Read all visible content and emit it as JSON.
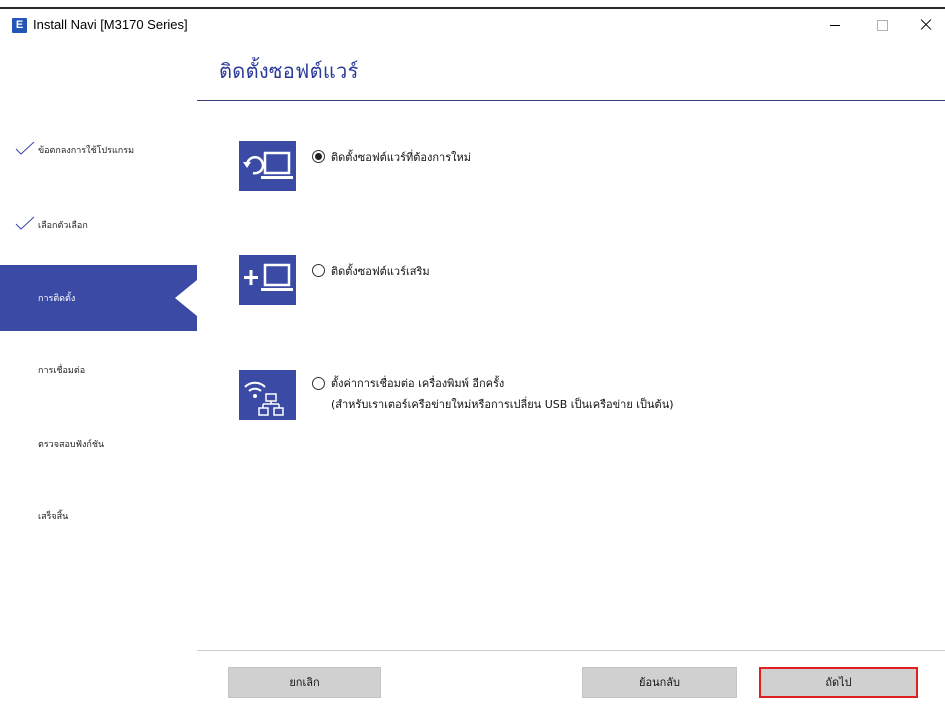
{
  "window": {
    "title": "Install Navi [M3170 Series]",
    "app_icon_letter": "E"
  },
  "header": {
    "title": "ติดตั้งซอฟต์แวร์"
  },
  "sidebar": {
    "steps": [
      {
        "label": "ข้อตกลงการใช้โปรแกรม",
        "state": "done"
      },
      {
        "label": "เลือกตัวเลือก",
        "state": "done"
      },
      {
        "label": "การติดตั้ง",
        "state": "active"
      },
      {
        "label": "การเชื่อมต่อ",
        "state": "pending"
      },
      {
        "label": "ตรวจสอบฟังก์ชัน",
        "state": "pending"
      },
      {
        "label": "เสร็จสิ้น",
        "state": "pending"
      }
    ]
  },
  "options": [
    {
      "label": "ติดตั้งซอฟต์แวร์ที่ต้องการใหม่",
      "selected": true,
      "icon": "refresh-computer-icon"
    },
    {
      "label": "ติดตั้งซอฟต์แวร์เสริม",
      "selected": false,
      "icon": "add-computer-icon"
    },
    {
      "label": "ตั้งค่าการเชื่อมต่อ เครื่องพิมพ์ อีกครั้ง",
      "sublabel": "(สำหรับเราเตอร์เครือข่ายใหม่หรือการเปลี่ยน USB เป็นเครือข่าย เป็นต้น)",
      "selected": false,
      "icon": "wifi-network-icon"
    }
  ],
  "footer": {
    "cancel_label": "ยกเลิก",
    "back_label": "ย้อนกลับ",
    "next_label": "ถัดไป"
  },
  "colors": {
    "accent": "#3b4aa5",
    "title": "#2b3a97",
    "highlight_border": "#e02020"
  }
}
